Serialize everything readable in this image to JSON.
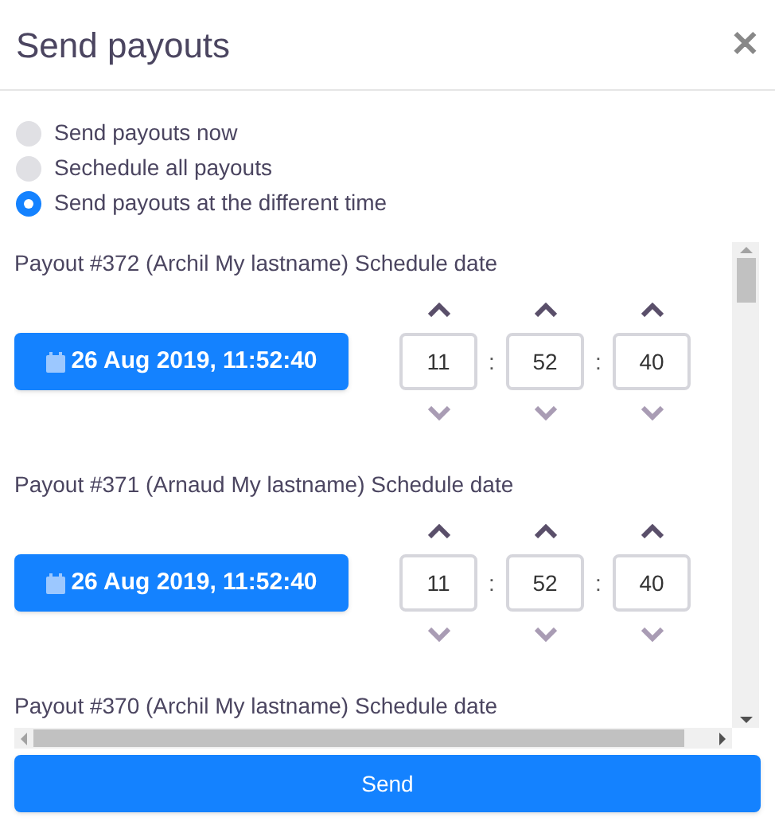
{
  "dialog": {
    "title": "Send payouts",
    "close": "✕"
  },
  "options": [
    {
      "label": "Send payouts now",
      "selected": false
    },
    {
      "label": "Sechedule all payouts",
      "selected": false
    },
    {
      "label": "Send payouts at the different time",
      "selected": true
    }
  ],
  "payouts": [
    {
      "title": "Payout #372 (Archil My lastname) Schedule date",
      "date": "26 Aug 2019, 11:52:40",
      "hours": "11",
      "minutes": "52",
      "seconds": "40",
      "separator": ":"
    },
    {
      "title": "Payout #371 (Arnaud My lastname) Schedule date",
      "date": "26 Aug 2019, 11:52:40",
      "hours": "11",
      "minutes": "52",
      "seconds": "40",
      "separator": ":"
    },
    {
      "title": "Payout #370 (Archil My lastname) Schedule date"
    }
  ],
  "send_button": "Send"
}
